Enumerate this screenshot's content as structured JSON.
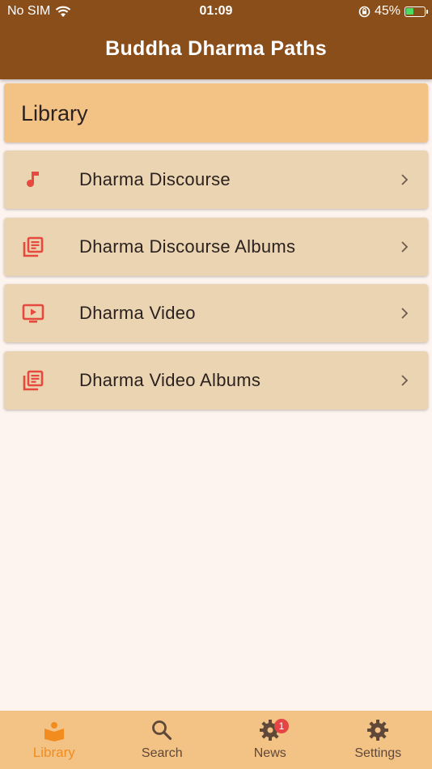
{
  "status": {
    "carrier": "No SIM",
    "time": "01:09",
    "battery": "45%",
    "battery_level": 0.45
  },
  "appbar": {
    "title": "Buddha Dharma Paths"
  },
  "section": {
    "title": "Library"
  },
  "items": [
    {
      "label": "Dharma Discourse",
      "icon": "music-note-icon"
    },
    {
      "label": "Dharma Discourse Albums",
      "icon": "library-books-icon"
    },
    {
      "label": "Dharma Video",
      "icon": "video-screen-icon"
    },
    {
      "label": "Dharma Video Albums",
      "icon": "library-books-icon"
    }
  ],
  "tabs": [
    {
      "label": "Library",
      "icon": "library-book-icon",
      "active": true
    },
    {
      "label": "Search",
      "icon": "search-icon"
    },
    {
      "label": "News",
      "icon": "news-gear-icon",
      "badge": "1"
    },
    {
      "label": "Settings",
      "icon": "settings-gear-icon"
    }
  ],
  "colors": {
    "appbar": "#8a4e1a",
    "header": "#f3c285",
    "item": "#ebd4b2",
    "icon_red": "#e64a3e",
    "active_tab": "#f28c1f",
    "background": "#fdf3ef"
  }
}
